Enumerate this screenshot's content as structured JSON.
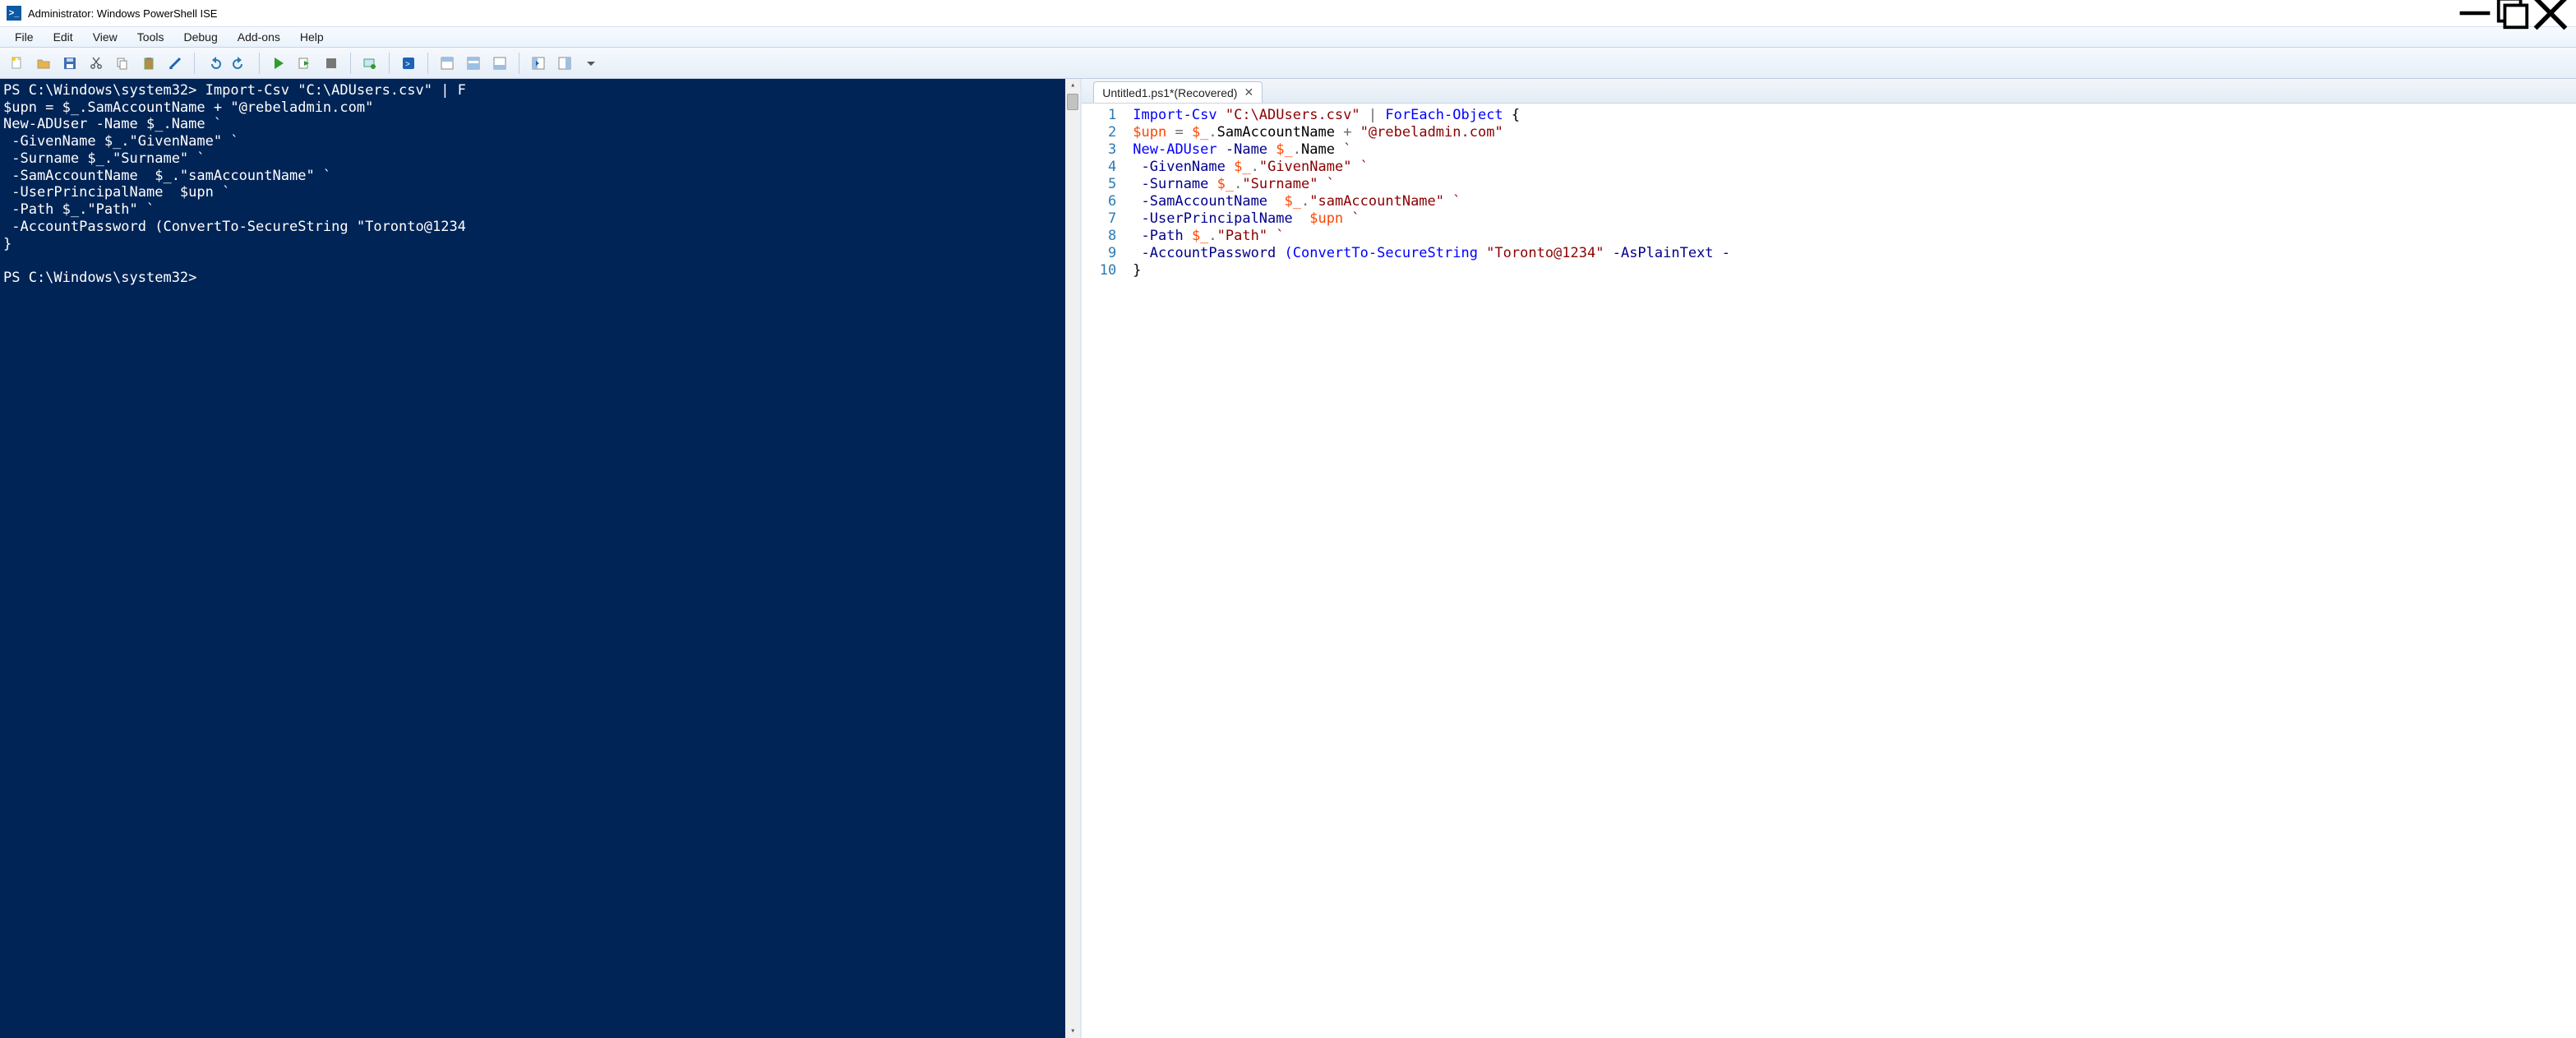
{
  "window": {
    "title": "Administrator: Windows PowerShell ISE",
    "icon_label": ">_"
  },
  "menus": [
    "File",
    "Edit",
    "View",
    "Tools",
    "Debug",
    "Add-ons",
    "Help"
  ],
  "toolbar_icons": [
    "new-file-icon",
    "open-file-icon",
    "save-icon",
    "cut-icon",
    "copy-icon",
    "paste-icon",
    "clear-icon",
    "|",
    "undo-icon",
    "redo-icon",
    "|",
    "run-icon",
    "run-selection-icon",
    "stop-icon",
    "|",
    "remote-icon",
    "|",
    "powershell-icon",
    "|",
    "pane-console-icon",
    "pane-split-icon",
    "pane-script-icon",
    "|",
    "pane-side1-icon",
    "pane-side2-icon",
    "overflow-icon"
  ],
  "console": {
    "lines": [
      "PS C:\\Windows\\system32> Import-Csv \"C:\\ADUsers.csv\" | F",
      "$upn = $_.SamAccountName + \"@rebeladmin.com\"",
      "New-ADUser -Name $_.Name `",
      " -GivenName $_.\"GivenName\" `",
      " -Surname $_.\"Surname\" `",
      " -SamAccountName  $_.\"samAccountName\" `",
      " -UserPrincipalName  $upn `",
      " -Path $_.\"Path\" `",
      " -AccountPassword (ConvertTo-SecureString \"Toronto@1234",
      "}",
      "",
      "PS C:\\Windows\\system32>"
    ]
  },
  "script": {
    "tab_label": "Untitled1.ps1*(Recovered)",
    "line_count": 10,
    "lines": [
      [
        {
          "t": "Import-Csv ",
          "c": "c-cmd"
        },
        {
          "t": "\"C:\\ADUsers.csv\"",
          "c": "c-str"
        },
        {
          "t": " ",
          "c": "c-text"
        },
        {
          "t": "|",
          "c": "c-op"
        },
        {
          "t": " ",
          "c": "c-text"
        },
        {
          "t": "ForEach-Object ",
          "c": "c-cmd"
        },
        {
          "t": "{",
          "c": "c-punc"
        }
      ],
      [
        {
          "t": "$upn ",
          "c": "c-var"
        },
        {
          "t": "= ",
          "c": "c-op"
        },
        {
          "t": "$_",
          "c": "c-var"
        },
        {
          "t": ".",
          "c": "c-op"
        },
        {
          "t": "SamAccountName ",
          "c": "c-text"
        },
        {
          "t": "+ ",
          "c": "c-op"
        },
        {
          "t": "\"@rebeladmin.com\"",
          "c": "c-str"
        }
      ],
      [
        {
          "t": "New-ADUser ",
          "c": "c-cmd"
        },
        {
          "t": "-Name ",
          "c": "c-param"
        },
        {
          "t": "$_",
          "c": "c-var"
        },
        {
          "t": ".",
          "c": "c-op"
        },
        {
          "t": "Name ",
          "c": "c-text"
        },
        {
          "t": "`",
          "c": "c-str"
        }
      ],
      [
        {
          "t": " ",
          "c": "c-text"
        },
        {
          "t": "-GivenName ",
          "c": "c-param"
        },
        {
          "t": "$_",
          "c": "c-var"
        },
        {
          "t": ".",
          "c": "c-op"
        },
        {
          "t": "\"GivenName\"",
          "c": "c-str"
        },
        {
          "t": " ",
          "c": "c-text"
        },
        {
          "t": "`",
          "c": "c-str"
        }
      ],
      [
        {
          "t": " ",
          "c": "c-text"
        },
        {
          "t": "-Surname ",
          "c": "c-param"
        },
        {
          "t": "$_",
          "c": "c-var"
        },
        {
          "t": ".",
          "c": "c-op"
        },
        {
          "t": "\"Surname\"",
          "c": "c-str"
        },
        {
          "t": " ",
          "c": "c-text"
        },
        {
          "t": "`",
          "c": "c-str"
        }
      ],
      [
        {
          "t": " ",
          "c": "c-text"
        },
        {
          "t": "-SamAccountName  ",
          "c": "c-param"
        },
        {
          "t": "$_",
          "c": "c-var"
        },
        {
          "t": ".",
          "c": "c-op"
        },
        {
          "t": "\"samAccountName\"",
          "c": "c-str"
        },
        {
          "t": " ",
          "c": "c-text"
        },
        {
          "t": "`",
          "c": "c-str"
        }
      ],
      [
        {
          "t": " ",
          "c": "c-text"
        },
        {
          "t": "-UserPrincipalName  ",
          "c": "c-param"
        },
        {
          "t": "$upn ",
          "c": "c-var"
        },
        {
          "t": "`",
          "c": "c-str"
        }
      ],
      [
        {
          "t": " ",
          "c": "c-text"
        },
        {
          "t": "-Path ",
          "c": "c-param"
        },
        {
          "t": "$_",
          "c": "c-var"
        },
        {
          "t": ".",
          "c": "c-op"
        },
        {
          "t": "\"Path\"",
          "c": "c-str"
        },
        {
          "t": " ",
          "c": "c-text"
        },
        {
          "t": "`",
          "c": "c-str"
        }
      ],
      [
        {
          "t": " ",
          "c": "c-text"
        },
        {
          "t": "-AccountPassword ",
          "c": "c-param"
        },
        {
          "t": "(",
          "c": "c-paren"
        },
        {
          "t": "ConvertTo-SecureString ",
          "c": "c-cmd"
        },
        {
          "t": "\"Toronto@1234\"",
          "c": "c-str"
        },
        {
          "t": " ",
          "c": "c-text"
        },
        {
          "t": "-AsPlainText ",
          "c": "c-param"
        },
        {
          "t": "-",
          "c": "c-param"
        }
      ],
      [
        {
          "t": "}",
          "c": "c-punc"
        }
      ]
    ]
  }
}
